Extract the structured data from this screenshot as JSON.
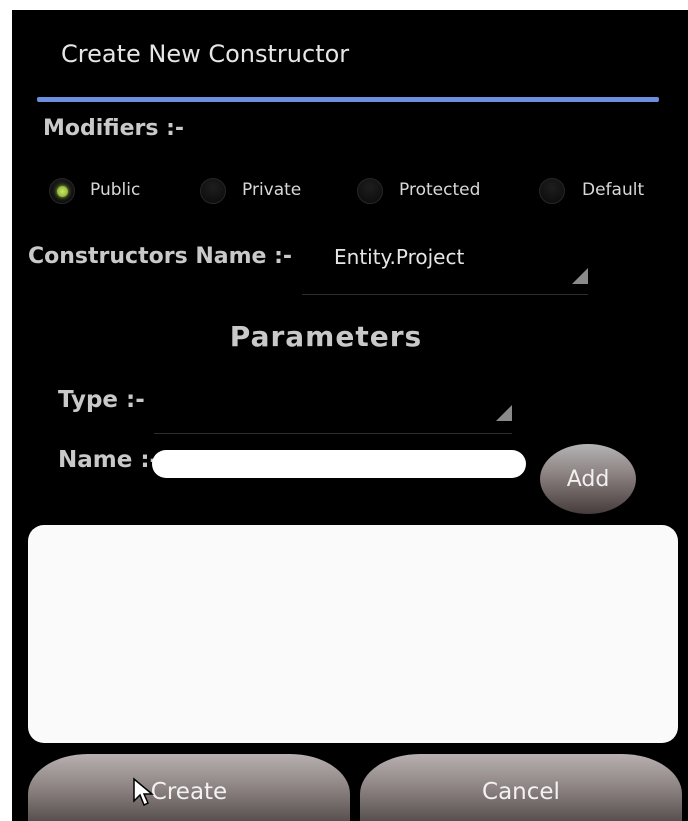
{
  "dialog": {
    "title": "Create New Constructor",
    "accent_color": "#6d8fe0"
  },
  "modifiers": {
    "label": "Modifiers :-",
    "options": [
      {
        "label": "Public",
        "checked": true
      },
      {
        "label": "Private",
        "checked": false
      },
      {
        "label": "Protected",
        "checked": false
      },
      {
        "label": "Default",
        "checked": false
      }
    ]
  },
  "constructor_name": {
    "label": "Constructors Name :-",
    "value": "Entity.Project"
  },
  "parameters": {
    "heading": "Parameters",
    "type_label": "Type :-",
    "type_value": "",
    "name_label": "Name :-",
    "name_value": "",
    "add_label": "Add"
  },
  "actions": {
    "create_label": "Create",
    "cancel_label": "Cancel"
  }
}
